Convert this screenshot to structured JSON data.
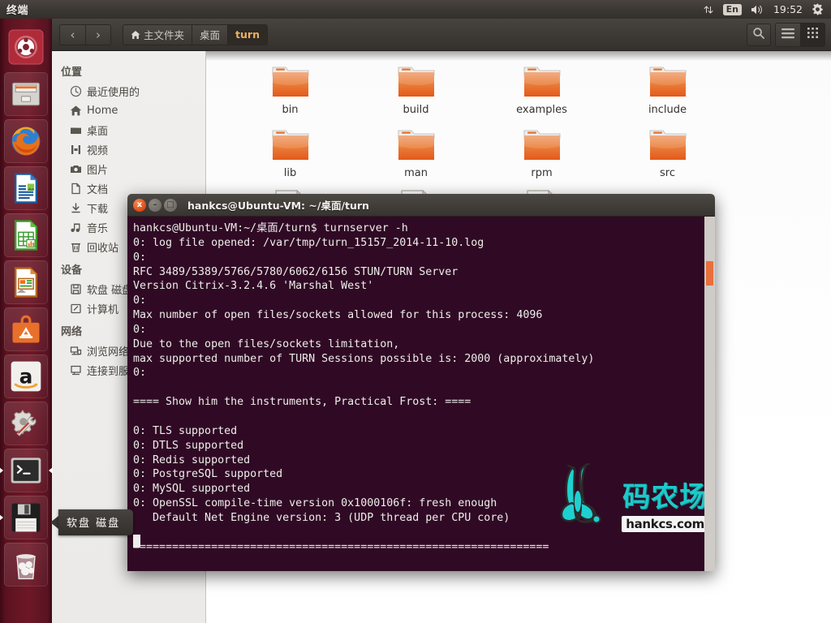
{
  "top_panel": {
    "app_title": "终端",
    "indicators": [
      {
        "name": "network-indicator",
        "glyph": "⇅"
      },
      {
        "name": "keyboard-layout-indicator",
        "label": "En"
      },
      {
        "name": "sound-indicator",
        "glyph": "🔊"
      }
    ],
    "clock": "19:52",
    "session_menu": "⚙"
  },
  "launcher": {
    "items": [
      {
        "name": "ubuntu-dash-icon",
        "label": "Dash 主页"
      },
      {
        "name": "files-nautilus-icon",
        "label": "文件"
      },
      {
        "name": "firefox-icon",
        "label": "Firefox 网络浏览器"
      },
      {
        "name": "libreoffice-writer-icon",
        "label": "LibreOffice Writer"
      },
      {
        "name": "libreoffice-calc-icon",
        "label": "LibreOffice Calc"
      },
      {
        "name": "libreoffice-impress-icon",
        "label": "LibreOffice Impress"
      },
      {
        "name": "ubuntu-software-center-icon",
        "label": "Ubuntu 软件中心"
      },
      {
        "name": "amazon-icon",
        "label": "Amazon"
      },
      {
        "name": "system-settings-icon",
        "label": "系统设置"
      },
      {
        "name": "terminal-icon",
        "label": "终端"
      },
      {
        "name": "floppy-disk-icon",
        "label": "软盘 磁盘"
      },
      {
        "name": "trash-icon",
        "label": "回收站"
      }
    ],
    "tooltip": "软盘 磁盘"
  },
  "file_manager": {
    "nav": {
      "back": "‹",
      "forward": "›"
    },
    "breadcrumb": [
      {
        "label": "主文件夹",
        "icon": "home-icon",
        "active": false
      },
      {
        "label": "桌面",
        "icon": "",
        "active": false
      },
      {
        "label": "turn",
        "icon": "",
        "active": true
      }
    ],
    "header_buttons": [
      {
        "name": "search-icon",
        "glyph": "search"
      },
      {
        "name": "menu-icon",
        "glyph": "hamburger"
      },
      {
        "name": "grid-view-icon",
        "glyph": "grid"
      }
    ],
    "sidebar": {
      "sections": [
        {
          "heading": "位置",
          "items": [
            {
              "label": "最近使用的",
              "icon": "clock-icon"
            },
            {
              "label": "Home",
              "icon": "home-icon"
            },
            {
              "label": "桌面",
              "icon": "desktop-folder-icon"
            },
            {
              "label": "视频",
              "icon": "video-icon"
            },
            {
              "label": "图片",
              "icon": "camera-icon"
            },
            {
              "label": "文档",
              "icon": "document-icon"
            },
            {
              "label": "下载",
              "icon": "download-icon"
            },
            {
              "label": "音乐",
              "icon": "music-note-icon"
            },
            {
              "label": "回收站",
              "icon": "trash-icon"
            }
          ]
        },
        {
          "heading": "设备",
          "items": [
            {
              "label": "软盘 磁盘",
              "icon": "floppy-disk-icon"
            },
            {
              "label": "计算机",
              "icon": "computer-icon"
            }
          ]
        },
        {
          "heading": "网络",
          "items": [
            {
              "label": "浏览网络",
              "icon": "network-browse-icon"
            },
            {
              "label": "连接到服务器",
              "icon": "connect-server-icon"
            }
          ]
        }
      ]
    },
    "files": [
      {
        "name": "bin",
        "type": "folder"
      },
      {
        "name": "build",
        "type": "folder"
      },
      {
        "name": "examples",
        "type": "folder"
      },
      {
        "name": "include",
        "type": "folder"
      },
      {
        "name": "lib",
        "type": "folder"
      },
      {
        "name": "man",
        "type": "folder"
      },
      {
        "name": "rpm",
        "type": "folder"
      },
      {
        "name": "src",
        "type": "folder"
      },
      {
        "name": "",
        "type": "document-text"
      },
      {
        "name": "",
        "type": "document-blank"
      },
      {
        "name": "",
        "type": "document-lines"
      }
    ]
  },
  "terminal": {
    "title": "hankcs@Ubuntu-VM: ~/桌面/turn",
    "window_buttons": {
      "close": "x",
      "minimize": "–",
      "maximize": "□"
    },
    "output": "hankcs@Ubuntu-VM:~/桌面/turn$ turnserver -h\n0: log file opened: /var/tmp/turn_15157_2014-11-10.log\n0:\nRFC 3489/5389/5766/5780/6062/6156 STUN/TURN Server\nVersion Citrix-3.2.4.6 'Marshal West'\n0:\nMax number of open files/sockets allowed for this process: 4096\n0:\nDue to the open files/sockets limitation,\nmax supported number of TURN Sessions possible is: 2000 (approximately)\n0:\n\n==== Show him the instruments, Practical Frost: ====\n\n0: TLS supported\n0: DTLS supported\n0: Redis supported\n0: PostgreSQL supported\n0: MySQL supported\n0: OpenSSL compile-time version 0x1000106f: fresh enough\n   Default Net Engine version: 3 (UDP thread per CPU core)\n\n================================================================"
  },
  "watermark": {
    "title": "码农场",
    "url": "hankcs.com",
    "color": "#1ec9c9"
  },
  "colors": {
    "terminal_bg": "#300a24",
    "launcher_bg": "#6e1726",
    "panel_bg": "#3c3833",
    "accent_orange": "#dd4814",
    "breadcrumb_active": "#f0b060"
  }
}
